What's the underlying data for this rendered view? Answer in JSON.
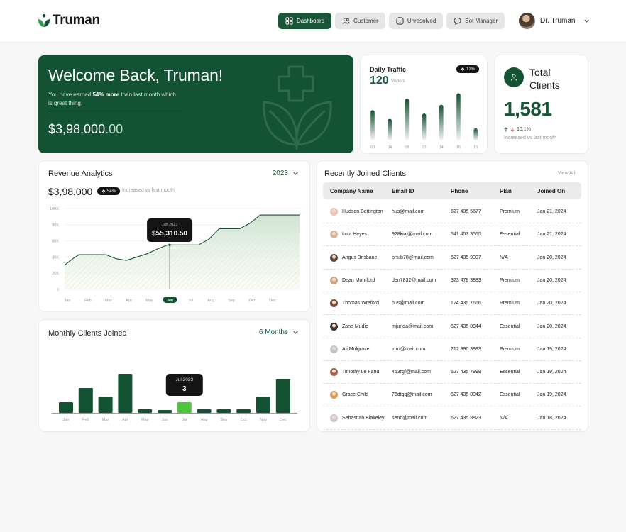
{
  "brand": {
    "name": "Truman"
  },
  "nav": {
    "items": [
      {
        "label": "Dashboard",
        "icon": "grid-icon",
        "active": true
      },
      {
        "label": "Customer",
        "icon": "users-icon",
        "active": false
      },
      {
        "label": "Unresolved",
        "icon": "alert-icon",
        "active": false
      },
      {
        "label": "Bot Manager",
        "icon": "chat-icon",
        "active": false
      }
    ]
  },
  "user": {
    "name": "Dr. Truman"
  },
  "welcome": {
    "title": "Welcome Back, Truman!",
    "msg_prefix": "You have earned ",
    "msg_highlight": "54% more",
    "msg_suffix": " than last month which is great thing.",
    "amount_main": "$3,98,000",
    "amount_decimal": ".00"
  },
  "traffic": {
    "title": "Daily Traffic",
    "count": "120",
    "unit": "Visitors",
    "badge": "12%",
    "chart_data": {
      "type": "bar",
      "categories": [
        "00",
        "04",
        "08",
        "12",
        "14",
        "16",
        "18"
      ],
      "values": [
        45,
        32,
        62,
        40,
        53,
        70,
        18
      ],
      "ylim": [
        0,
        80
      ]
    }
  },
  "total_clients": {
    "title": "Total Clients",
    "value": "1,581",
    "change": "10,1%",
    "note": "Increased vs last month"
  },
  "revenue": {
    "title": "Revenue Analytics",
    "year": "2023",
    "amount": "$3,98,000",
    "badge": "54%",
    "note": "Increased vs last month",
    "tooltip_month": "Jun 2023",
    "tooltip_value": "$55,310.50",
    "chart_data": {
      "type": "area",
      "categories": [
        "Jan",
        "Feb",
        "Mar",
        "Apr",
        "May",
        "Jun",
        "Jul",
        "Aug",
        "Sep",
        "Oct",
        "Dec"
      ],
      "y_ticks": [
        "0",
        "20K",
        "40K",
        "60K",
        "80K",
        "100K"
      ],
      "ylim": [
        0,
        100000
      ],
      "highlight": "Jun",
      "series": [
        {
          "x": [
            0,
            0.4,
            0.7,
            1.0,
            1.4,
            2.0,
            2.5,
            3.0,
            4.0,
            4.5,
            5.0,
            6.0,
            6.5,
            7.0,
            7.5,
            8.0,
            8.5,
            9.0,
            9.5,
            10.0,
            11.4
          ],
          "values": [
            30000,
            38000,
            43000,
            43000,
            43000,
            43000,
            38000,
            36000,
            44000,
            50000,
            55000,
            55000,
            55000,
            62000,
            75000,
            75000,
            75000,
            82000,
            92000,
            92000,
            92000
          ]
        }
      ]
    }
  },
  "monthly": {
    "title": "Monthly Clients Joined",
    "period": "6 Months",
    "tooltip_month": "Jul 2023",
    "tooltip_value": "3",
    "chart_data": {
      "type": "bar",
      "categories": [
        "Jan",
        "Feb",
        "Mar",
        "Apr",
        "May",
        "Jun",
        "Jul",
        "Aug",
        "Sep",
        "Oct",
        "Nov",
        "Dec"
      ],
      "values": [
        3,
        7,
        4.5,
        11,
        1,
        0.8,
        3,
        1,
        1,
        1,
        4.5,
        9.5
      ],
      "ylim": [
        0,
        12
      ],
      "highlight": "Jul"
    }
  },
  "clients": {
    "title": "Recently Joined Clients",
    "view_all": "View All",
    "columns": [
      "Company Name",
      "Email ID",
      "Phone",
      "Plan",
      "Joined On"
    ],
    "rows": [
      {
        "name": "Hudson Bettington",
        "email": "hus@mail.com",
        "phone": "627 435 5677",
        "plan": "Premium",
        "joined": "Jan 21, 2024",
        "avatar_color": "#e7c3b8"
      },
      {
        "name": "Lola Heyes",
        "email": "928kiaj@mail.com",
        "phone": "541 453 3565",
        "plan": "Essential",
        "joined": "Jan 21, 2024",
        "avatar_color": "#d6b49a"
      },
      {
        "name": "Angus Brisbane",
        "email": "brtub78@mail.com",
        "phone": "627 435 9007",
        "plan": "N/A",
        "joined": "Jan 20, 2024",
        "avatar_color": "#5a4a40"
      },
      {
        "name": "Dean Montford",
        "email": "den7832@mail.com",
        "phone": "323 478 3883",
        "plan": "Premium",
        "joined": "Jan 20, 2024",
        "avatar_color": "#c9a48a"
      },
      {
        "name": "Thomas Wreford",
        "email": "hus@mail.com",
        "phone": "124 435 7666",
        "plan": "Premium",
        "joined": "Jan 20, 2024",
        "avatar_color": "#7a4a3a"
      },
      {
        "name": "Zane Mudie",
        "email": "mjunda@mail.com",
        "phone": "627 435 0944",
        "plan": "Essential",
        "joined": "Jan 20, 2024",
        "avatar_color": "#3b3531"
      },
      {
        "name": "Ali Mulgrave",
        "email": "jdrrt@mail.com",
        "phone": "212 890 3993",
        "plan": "Premium",
        "joined": "Jan 19, 2024",
        "avatar_color": "#b8c7d2"
      },
      {
        "name": "Timothy Le Fanu",
        "email": "453rgf@mail.com",
        "phone": "627 435 7999",
        "plan": "Essential",
        "joined": "Jan 19, 2024",
        "avatar_color": "#a3624f"
      },
      {
        "name": "Grace Child",
        "email": "76dtgg@mail.com",
        "phone": "627 435 0042",
        "plan": "Essential",
        "joined": "Jan 19, 2024",
        "avatar_color": "#e09a4e"
      },
      {
        "name": "Sebastian Blakeley",
        "email": "senb@mail.com",
        "phone": "627 435 8823",
        "plan": "N/A",
        "joined": "Jan 18, 2024",
        "avatar_color": "#c8c8d0"
      }
    ]
  },
  "colors": {
    "brand_green": "#135233",
    "accent_green": "#1a5538",
    "highlight_lime": "#4fc53f",
    "dark": "#141414"
  }
}
